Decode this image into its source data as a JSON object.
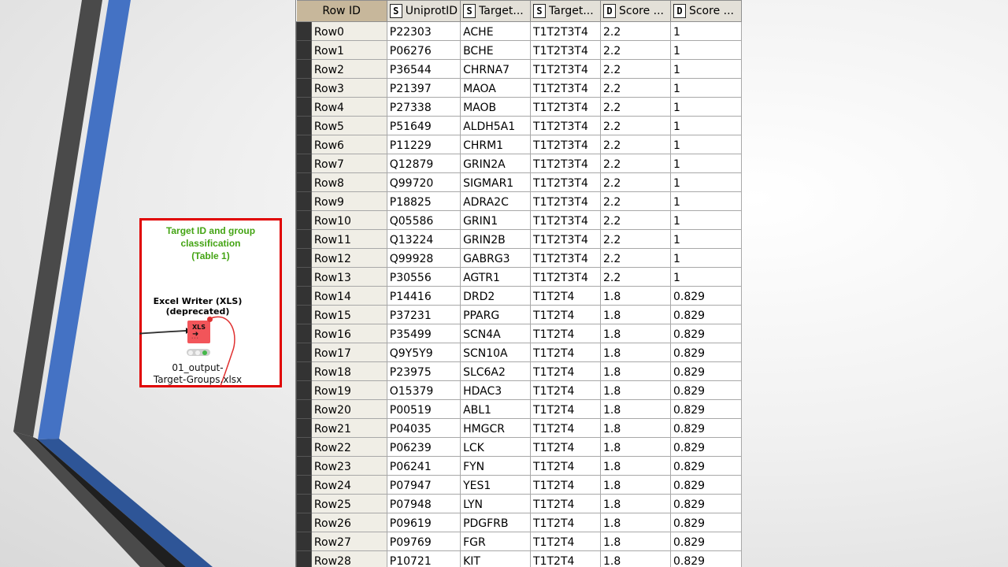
{
  "annotation": {
    "title_lines": [
      "Target ID and group",
      "classification",
      "(Table 1)"
    ],
    "node_name_lines": [
      "Excel Writer (XLS)",
      "(deprecated)"
    ],
    "node_icon_text": "XLS",
    "node_label_lines": [
      "01_output-",
      "Target-Groups.xlsx"
    ],
    "border_color": "#e00000",
    "title_color": "#44a414",
    "node_color": "#f2555a"
  },
  "table": {
    "columns": [
      {
        "label": "Row ID",
        "type": ""
      },
      {
        "label": "UniprotID",
        "type": "S"
      },
      {
        "label": "Target...",
        "type": "S"
      },
      {
        "label": "Target...",
        "type": "S"
      },
      {
        "label": "Score ...",
        "type": "D"
      },
      {
        "label": "Score ...",
        "type": "D"
      }
    ],
    "rows": [
      [
        "Row0",
        "P22303",
        "ACHE",
        "T1T2T3T4",
        "2.2",
        "1"
      ],
      [
        "Row1",
        "P06276",
        "BCHE",
        "T1T2T3T4",
        "2.2",
        "1"
      ],
      [
        "Row2",
        "P36544",
        "CHRNA7",
        "T1T2T3T4",
        "2.2",
        "1"
      ],
      [
        "Row3",
        "P21397",
        "MAOA",
        "T1T2T3T4",
        "2.2",
        "1"
      ],
      [
        "Row4",
        "P27338",
        "MAOB",
        "T1T2T3T4",
        "2.2",
        "1"
      ],
      [
        "Row5",
        "P51649",
        "ALDH5A1",
        "T1T2T3T4",
        "2.2",
        "1"
      ],
      [
        "Row6",
        "P11229",
        "CHRM1",
        "T1T2T3T4",
        "2.2",
        "1"
      ],
      [
        "Row7",
        "Q12879",
        "GRIN2A",
        "T1T2T3T4",
        "2.2",
        "1"
      ],
      [
        "Row8",
        "Q99720",
        "SIGMAR1",
        "T1T2T3T4",
        "2.2",
        "1"
      ],
      [
        "Row9",
        "P18825",
        "ADRA2C",
        "T1T2T3T4",
        "2.2",
        "1"
      ],
      [
        "Row10",
        "Q05586",
        "GRIN1",
        "T1T2T3T4",
        "2.2",
        "1"
      ],
      [
        "Row11",
        "Q13224",
        "GRIN2B",
        "T1T2T3T4",
        "2.2",
        "1"
      ],
      [
        "Row12",
        "Q99928",
        "GABRG3",
        "T1T2T3T4",
        "2.2",
        "1"
      ],
      [
        "Row13",
        "P30556",
        "AGTR1",
        "T1T2T3T4",
        "2.2",
        "1"
      ],
      [
        "Row14",
        "P14416",
        "DRD2",
        "T1T2T4",
        "1.8",
        "0.829"
      ],
      [
        "Row15",
        "P37231",
        "PPARG",
        "T1T2T4",
        "1.8",
        "0.829"
      ],
      [
        "Row16",
        "P35499",
        "SCN4A",
        "T1T2T4",
        "1.8",
        "0.829"
      ],
      [
        "Row17",
        "Q9Y5Y9",
        "SCN10A",
        "T1T2T4",
        "1.8",
        "0.829"
      ],
      [
        "Row18",
        "P23975",
        "SLC6A2",
        "T1T2T4",
        "1.8",
        "0.829"
      ],
      [
        "Row19",
        "O15379",
        "HDAC3",
        "T1T2T4",
        "1.8",
        "0.829"
      ],
      [
        "Row20",
        "P00519",
        "ABL1",
        "T1T2T4",
        "1.8",
        "0.829"
      ],
      [
        "Row21",
        "P04035",
        "HMGCR",
        "T1T2T4",
        "1.8",
        "0.829"
      ],
      [
        "Row22",
        "P06239",
        "LCK",
        "T1T2T4",
        "1.8",
        "0.829"
      ],
      [
        "Row23",
        "P06241",
        "FYN",
        "T1T2T4",
        "1.8",
        "0.829"
      ],
      [
        "Row24",
        "P07947",
        "YES1",
        "T1T2T4",
        "1.8",
        "0.829"
      ],
      [
        "Row25",
        "P07948",
        "LYN",
        "T1T2T4",
        "1.8",
        "0.829"
      ],
      [
        "Row26",
        "P09619",
        "PDGFRB",
        "T1T2T4",
        "1.8",
        "0.829"
      ],
      [
        "Row27",
        "P09769",
        "FGR",
        "T1T2T4",
        "1.8",
        "0.829"
      ],
      [
        "Row28",
        "P10721",
        "KIT",
        "T1T2T4",
        "1.8",
        "0.829"
      ]
    ]
  }
}
